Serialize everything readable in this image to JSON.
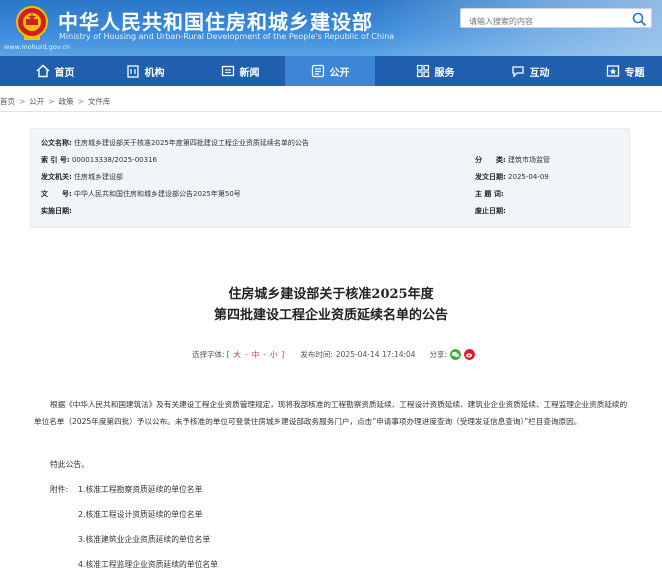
{
  "header": {
    "site_title": "中华人民共和国住房和城乡建设部",
    "site_subtitle": "Ministry of Housing and Urban-Rural Development of the People's Republic of China",
    "site_url": "www.mohurd.gov.cn",
    "search_placeholder": "请输入搜索的内容"
  },
  "nav": {
    "items": [
      {
        "label": "首页",
        "icon": "home-icon"
      },
      {
        "label": "机构",
        "icon": "building-icon"
      },
      {
        "label": "新闻",
        "icon": "news-icon"
      },
      {
        "label": "公开",
        "icon": "disclosure-icon"
      },
      {
        "label": "服务",
        "icon": "service-icon"
      },
      {
        "label": "互动",
        "icon": "interaction-icon"
      },
      {
        "label": "专题",
        "icon": "topic-icon"
      }
    ],
    "active": "公开"
  },
  "breadcrumb": [
    "首页",
    "公开",
    "政策",
    "文件库"
  ],
  "info": {
    "title_label": "公文名称:",
    "title_value": "住房城乡建设部关于核准2025年度第四批建设工程企业资质延续名单的公告",
    "index_label": "索 引 号:",
    "index_value": "000013338/2025-00316",
    "category_label": "分　　类:",
    "category_value": "建筑市场监管",
    "issuer_label": "发文机关:",
    "issuer_value": "住房城乡建设部",
    "date_label": "发文日期:",
    "date_value": "2025-04-09",
    "docno_label": "文　　号:",
    "docno_value": "中华人民共和国住房和城乡建设部公告2025年第50号",
    "subject_label": "主 题 词:",
    "subject_value": "",
    "impl_label": "实施日期:",
    "impl_value": "",
    "expire_label": "废止日期:",
    "expire_value": ""
  },
  "article": {
    "title_line1": "住房城乡建设部关于核准2025年度",
    "title_line2": "第四批建设工程企业资质延续名单的公告",
    "font_label": "选择字体:",
    "font_open": "[",
    "font_large": "大",
    "font_medium": "中",
    "font_small": "小",
    "font_close": "]",
    "font_dash": "-",
    "publish_label": "发布时间:",
    "publish_time": "2025-04-14 17:14:04",
    "share_label": "分享:",
    "body": "根据《中华人民共和国建筑法》及有关建设工程企业资质管理规定，现将我部核准的工程勘察资质延续、工程设计资质延续、建筑业企业资质延续、工程监理企业资质延续的单位名单（2025年度第四批）予以公布。未予核准的单位可登录住房城乡建设部政务服务门户，点击“申请事项办理进度查询（受理发证信息查询）”栏目查询原因。",
    "closing": "特此公告。",
    "attach_label": "附件:",
    "attachments": [
      "1.核准工程勘察资质延续的单位名单",
      "2.核准工程设计资质延续的单位名单",
      "3.核准建筑业企业资质延续的单位名单",
      "4.核准工程监理企业资质延续的单位名单"
    ]
  },
  "colors": {
    "header_blue": "#2b76c8",
    "nav_blue": "#1f5fae",
    "nav_active": "#3d86d6",
    "wechat_green": "#3cb034",
    "weibo_red": "#e6162d"
  }
}
